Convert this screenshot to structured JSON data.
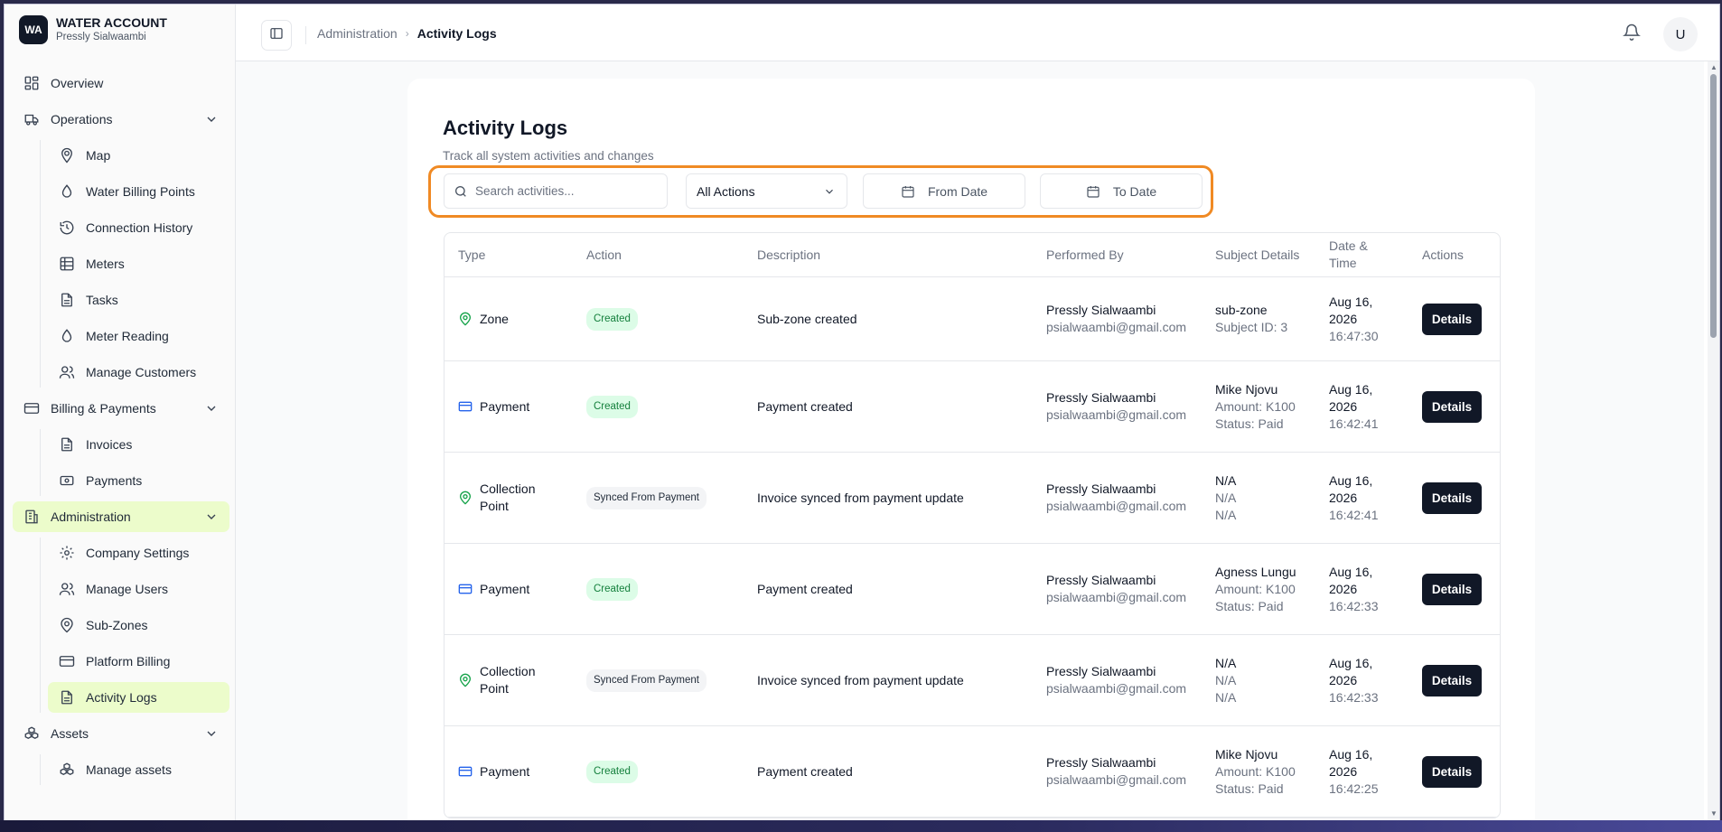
{
  "app": {
    "logo": "WA",
    "title": "WATER ACCOUNT",
    "user": "Pressly Sialwaambi"
  },
  "sidebar": {
    "overview": "Overview",
    "operations": {
      "label": "Operations",
      "items": [
        "Map",
        "Water Billing Points",
        "Connection History",
        "Meters",
        "Tasks",
        "Meter Reading",
        "Manage Customers"
      ]
    },
    "billing": {
      "label": "Billing & Payments",
      "items": [
        "Invoices",
        "Payments"
      ]
    },
    "administration": {
      "label": "Administration",
      "items": [
        "Company Settings",
        "Manage Users",
        "Sub-Zones",
        "Platform Billing",
        "Activity Logs"
      ]
    },
    "assets": {
      "label": "Assets",
      "items": [
        "Manage assets"
      ]
    }
  },
  "header": {
    "breadcrumb_parent": "Administration",
    "breadcrumb_current": "Activity Logs",
    "avatar_initial": "U"
  },
  "page": {
    "title": "Activity Logs",
    "subtitle": "Track all system activities and changes"
  },
  "filters": {
    "search_placeholder": "Search activities...",
    "action_selected": "All Actions",
    "from_date": "From Date",
    "to_date": "To Date"
  },
  "table": {
    "columns": [
      "Type",
      "Action",
      "Description",
      "Performed By",
      "Subject Details",
      "Date & Time",
      "Actions"
    ],
    "details_label": "Details",
    "rows": [
      {
        "type": "Zone",
        "icon": "map-pin-icon",
        "action": "Created",
        "badge": "created",
        "description": "Sub-zone created",
        "by_name": "Pressly Sialwaambi",
        "by_email": "psialwaambi@gmail.com",
        "subject": [
          "sub-zone",
          "Subject ID: 3"
        ],
        "date": "Aug 16, 2026",
        "time": "16:47:30"
      },
      {
        "type": "Payment",
        "icon": "credit-card-icon",
        "action": "Created",
        "badge": "created",
        "description": "Payment created",
        "by_name": "Pressly Sialwaambi",
        "by_email": "psialwaambi@gmail.com",
        "subject": [
          "Mike Njovu",
          "Amount: K100",
          "Status: Paid"
        ],
        "date": "Aug 16, 2026",
        "time": "16:42:41"
      },
      {
        "type": "Collection Point",
        "icon": "map-pin-icon",
        "action": "Synced From Payment",
        "badge": "synced",
        "description": "Invoice synced from payment update",
        "by_name": "Pressly Sialwaambi",
        "by_email": "psialwaambi@gmail.com",
        "subject": [
          "N/A",
          "N/A",
          "N/A"
        ],
        "date": "Aug 16, 2026",
        "time": "16:42:41"
      },
      {
        "type": "Payment",
        "icon": "credit-card-icon",
        "action": "Created",
        "badge": "created",
        "description": "Payment created",
        "by_name": "Pressly Sialwaambi",
        "by_email": "psialwaambi@gmail.com",
        "subject": [
          "Agness Lungu",
          "Amount: K100",
          "Status: Paid"
        ],
        "date": "Aug 16, 2026",
        "time": "16:42:33"
      },
      {
        "type": "Collection Point",
        "icon": "map-pin-icon",
        "action": "Synced From Payment",
        "badge": "synced",
        "description": "Invoice synced from payment update",
        "by_name": "Pressly Sialwaambi",
        "by_email": "psialwaambi@gmail.com",
        "subject": [
          "N/A",
          "N/A",
          "N/A"
        ],
        "date": "Aug 16, 2026",
        "time": "16:42:33"
      },
      {
        "type": "Payment",
        "icon": "credit-card-icon",
        "action": "Created",
        "badge": "created",
        "description": "Payment created",
        "by_name": "Pressly Sialwaambi",
        "by_email": "psialwaambi@gmail.com",
        "subject": [
          "Mike Njovu",
          "Amount: K100",
          "Status: Paid"
        ],
        "date": "Aug 16, 2026",
        "time": "16:42:25"
      }
    ]
  },
  "colors": {
    "accent_highlight": "#f08a24",
    "active_nav": "#ecfccb",
    "badge_created_bg": "#dcfce7",
    "badge_created_text": "#15803d",
    "zone_icon": "#16a34a",
    "payment_icon": "#2563eb",
    "button_dark": "#111827"
  }
}
